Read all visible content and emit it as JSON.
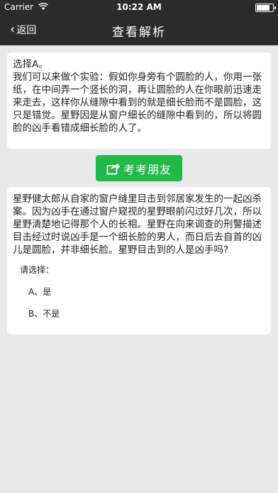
{
  "statusbar": {
    "carrier": "Carrier",
    "time": "10:22 AM"
  },
  "navbar": {
    "back_label": "返回",
    "title": "查看解析"
  },
  "answer": {
    "line1": "选择A。",
    "text": "我们可以来做个实验：假如你身旁有个圆脸的人，你用一张纸，在中间弄一个竖长的洞，再让圆脸的人在你眼前迅速走来走去，这样你从缝隙中看到的就是细长脸而不是圆脸，这只是错觉。星野因是从窗户细长的缝隙中看到的，所以将圆脸的凶手看错成细长脸的人了。"
  },
  "share_button": {
    "label": "考考朋友",
    "icon": "share-icon"
  },
  "question": {
    "text": "星野健太郎从自家的窗户缝里目击到邻居家发生的一起凶杀案。因为凶手在通过窗户窥视的星野眼前闪过好几次，所以星野清楚地记得那个人的长相。星野在向来调查的刑警描述目击经过时说凶手是一个细长脸的男人，而日后去自首的凶儿是圆脸，并非细长脸。星野目击到的人是凶手吗?",
    "prompt": "请选择：",
    "options": [
      "A、是",
      "B、不是"
    ]
  },
  "colors": {
    "bar": "#2b2b2b",
    "accent": "#23b84a",
    "background": "#e9e9ea"
  }
}
